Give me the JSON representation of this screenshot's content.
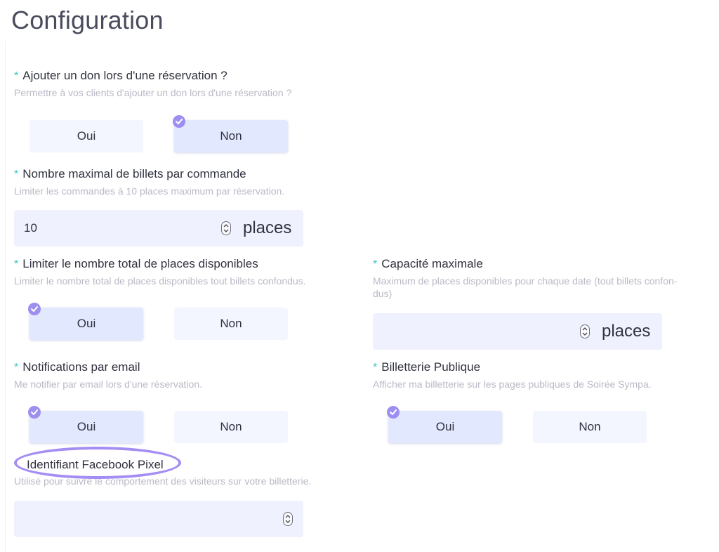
{
  "page": {
    "title": "Configuration"
  },
  "donation": {
    "asterisk": "*",
    "label": "Ajouter un don lors d'une réservation ?",
    "help": "Permettre à vos clients d'ajouter un don lors d'une réservation ?",
    "options": [
      "Oui",
      "Non"
    ],
    "selected": "Non"
  },
  "max_tickets": {
    "asterisk": "*",
    "label": "Nombre maximal de billets par commande",
    "help": "Limiter les commandes à 10 places maximum par réservation.",
    "value": "10",
    "unit": "places"
  },
  "limit_total": {
    "asterisk": "*",
    "label": "Limiter le nombre total de places disponibles",
    "help": "Limiter le nombre total de places disponibles tout billets confondus.",
    "options": [
      "Oui",
      "Non"
    ],
    "selected": "Oui"
  },
  "capacity": {
    "asterisk": "*",
    "label": "Capacité maximale",
    "help_line1": "Maximum de places disponibles pour chaque date (tout billets confon-",
    "help_line2": "dus)",
    "value": "",
    "unit": "places"
  },
  "email_notifications": {
    "asterisk": "*",
    "label": "Notifications par email",
    "help": "Me notifier par email lors d'une réservation.",
    "options": [
      "Oui",
      "Non"
    ],
    "selected": "Oui"
  },
  "public_ticketing": {
    "asterisk": "*",
    "label": "Billetterie Publique",
    "help": "Afficher ma billetterie sur les pages publiques de Soirée Sympa.",
    "options": [
      "Oui",
      "Non"
    ],
    "selected": "Oui"
  },
  "facebook_pixel": {
    "label": "Identifiant Facebook Pixel",
    "help": "Utilisé pour suivre le comportement des visiteurs sur votre billetterie.",
    "value": ""
  },
  "colors": {
    "required_asterisk": "#3ec6c0",
    "check_badge": "#9d8ff0",
    "highlight_ring": "#a48df3",
    "toggle_bg": "#f3f5ff",
    "toggle_selected_bg": "#e2e8fd",
    "input_bg": "#f0f1fe"
  },
  "icons": {
    "check": "check-circle-icon",
    "spinner": "spinner-arrows-icon"
  }
}
